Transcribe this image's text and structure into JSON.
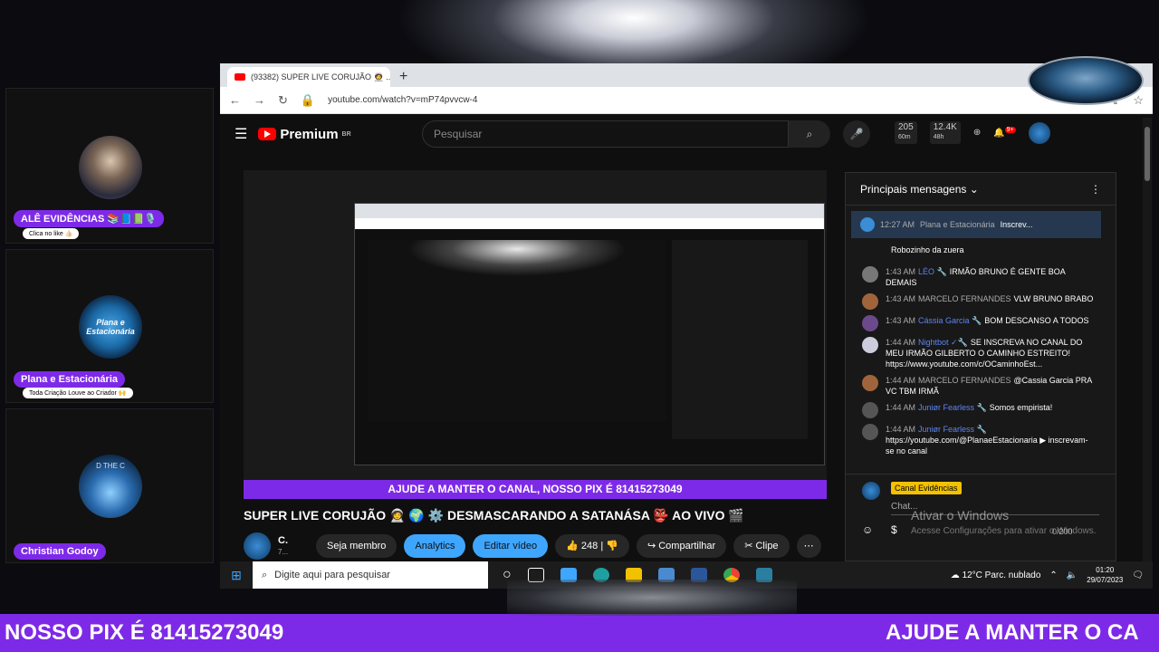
{
  "cams": [
    {
      "name": "ALÊ EVIDÊNCIAS 📚📘📗🎙️",
      "sub": "Clica no like 👍🏻"
    },
    {
      "name": "Plana e Estacionária",
      "sub": "Toda Criação Louve ao Criador 🙌",
      "logo_text": "Plana e Estacionária"
    },
    {
      "name": "Christian Godoy",
      "globe_text": "D THE C"
    }
  ],
  "browser": {
    "tab_title": "(93382) SUPER LIVE CORUJÃO 🧑‍🚀 ...",
    "new_tab": "+",
    "url": "youtube.com/watch?v=mP74pvvcw-4"
  },
  "youtube": {
    "logo": "Premium",
    "logo_region": "BR",
    "search_placeholder": "Pesquisar",
    "stats": [
      {
        "top": "205",
        "bottom": "60m"
      },
      {
        "top": "12.4K",
        "bottom": "48h"
      }
    ],
    "notif_count": "9+"
  },
  "player": {
    "banner": "AJUDE A MANTER O CANAL, NOSSO PIX É 81415273049"
  },
  "video": {
    "title": "SUPER LIVE CORUJÃO 🧑‍🚀 🌍 ⚙️ DESMASCARANDO A SATANÁSA 👺 AO VIVO 🎬",
    "channel_short": "C.",
    "channel_sub": "7...",
    "join": "Seja membro",
    "analytics": "Analytics",
    "edit": "Editar vídeo",
    "likes": "248",
    "share": "Compartilhar",
    "clip": "Clipe",
    "more": "⋯"
  },
  "chat": {
    "header": "Principais mensagens",
    "pinned": {
      "time": "12:27 AM",
      "author": "Plana e Estacionária",
      "text": "Inscrev..."
    },
    "messages": [
      {
        "time": "",
        "author": "",
        "text": "Robozinho da zuera",
        "mod": false
      },
      {
        "time": "1:43 AM",
        "author": "LÉO 🔧",
        "text": "IRMÃO BRUNO É GENTE BOA DEMAIS",
        "mod": true
      },
      {
        "time": "1:43 AM",
        "author": "MARCELO FERNANDES",
        "text": "VLW BRUNO BRABO",
        "mod": false
      },
      {
        "time": "1:43 AM",
        "author": "Cássia Garcia 🔧",
        "text": "BOM DESCANSO A TODOS",
        "mod": true
      },
      {
        "time": "1:44 AM",
        "author": "Nightbot ✓🔧",
        "text": "SE INSCREVA NO CANAL DO MEU IRMÃO GILBERTO O CAMINHO ESTREITO! https://www.youtube.com/c/OCaminhoEst...",
        "mod": true
      },
      {
        "time": "1:44 AM",
        "author": "MARCELO FERNANDES",
        "text": "@Cassia Garcia PRA VC TBM IRMÃ",
        "mod": false
      },
      {
        "time": "1:44 AM",
        "author": "Juniør Fearless 🔧",
        "text": "Somos empirista!",
        "mod": true
      },
      {
        "time": "1:44 AM",
        "author": "Juniør Fearless 🔧",
        "text": "https://youtube.com/@PlanaeEstacionaria ▶ inscrevam-se no canal",
        "mod": true
      }
    ],
    "input_channel": "Canal Evidências",
    "input_placeholder": "Chat...",
    "char_count": "0/200"
  },
  "watermark": {
    "line1": "Ativar o Windows",
    "line2": "Acesse Configurações para ativar o Windows."
  },
  "taskbar": {
    "search_placeholder": "Digite aqui para pesquisar",
    "weather": "12°C  Parc. nublado",
    "time": "01:20",
    "date": "29/07/2023"
  },
  "ticker": {
    "left": "NOSSO PIX É 81415273049",
    "right": "AJUDE A MANTER O CA"
  },
  "colors": {
    "brand_purple": "#7d2ae8",
    "youtube_red": "#ff0000",
    "chat_blue": "#3ea6ff"
  }
}
